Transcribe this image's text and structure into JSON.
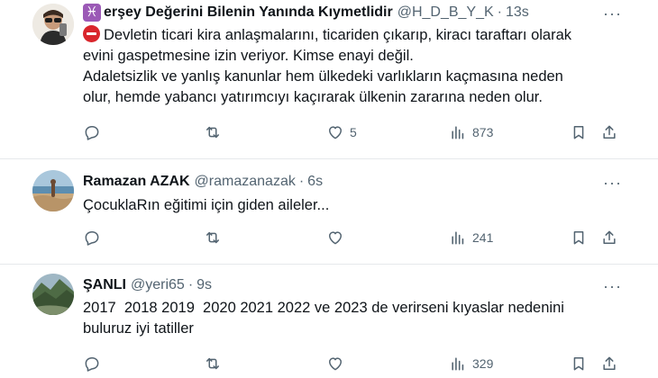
{
  "tweets": [
    {
      "name": "erşey Değerini Bilenin Yanında Kıymetlidir",
      "handle": "@H_D_B_Y_K",
      "separator": "·",
      "time": "13s",
      "more": "···",
      "lines": [
        "Devletin ticari kira anlaşmalarını, ticariden çıkarıp, kiracı taraftarı olarak",
        "evini gaspetmesine izin veriyor. Kimse enayi değil.",
        "Adaletsizlik ve yanlış kanunlar hem ülkedeki varlıkların kaçmasına neden",
        "olur, hemde yabancı yatırımcıyı kaçırarak ülkenin zararına neden olur."
      ],
      "likes": "5",
      "views": "873"
    },
    {
      "name": "Ramazan AZAK",
      "handle": "@ramazanazak",
      "separator": "·",
      "time": "6s",
      "more": "···",
      "lines": [
        "ÇocuklaRın eğitimi için giden aileler..."
      ],
      "views": "241"
    },
    {
      "name": "ŞANLI",
      "handle": "@yeri65",
      "separator": "·",
      "time": "9s",
      "more": "···",
      "lines": [
        "2017  2018 2019  2020 2021 2022 ve 2023 de verirseni kıyaslar nedenini",
        "buluruz iyi tatiller"
      ],
      "views": "329"
    }
  ],
  "icons": {
    "zodiac": "♓",
    "no_entry": "no-entry-icon"
  }
}
